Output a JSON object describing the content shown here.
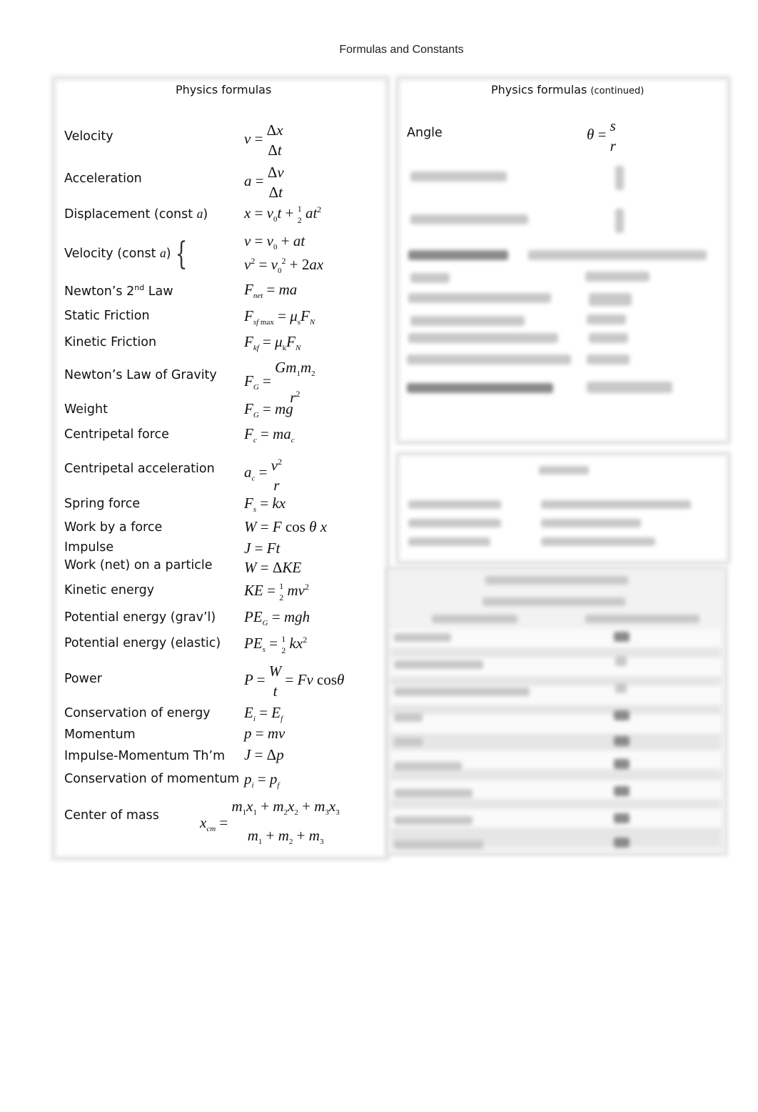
{
  "document": {
    "title": "Formulas and Constants"
  },
  "left_panel": {
    "heading": "Physics formulas",
    "rows": [
      {
        "label": "Velocity",
        "formula": "v = Δx / Δt"
      },
      {
        "label": "Acceleration",
        "formula": "a = Δv / Δt"
      },
      {
        "label": "Displacement (const a)",
        "formula": "x = v0 t + ½ a t²"
      },
      {
        "label": "Velocity (const a)",
        "formula": "v = v0 + at ; v² = v0² + 2ax"
      },
      {
        "label": "Newton’s 2nd Law",
        "formula": "F_net = ma"
      },
      {
        "label": "Static Friction",
        "formula": "F_sf max = μs F_N"
      },
      {
        "label": "Kinetic Friction",
        "formula": "F_kf = μk F_N"
      },
      {
        "label": "Newton’s Law of Gravity",
        "formula": "F_G = G m1 m2 / r²"
      },
      {
        "label": "Weight",
        "formula": "F_G = mg"
      },
      {
        "label": "Centripetal force",
        "formula": "F_c = m a_c"
      },
      {
        "label": "Centripetal acceleration",
        "formula": "a_c = v² / r"
      },
      {
        "label": "Spring force",
        "formula": "F_s = kx"
      },
      {
        "label": "Work by a force",
        "formula": "W = F cos θ x"
      },
      {
        "label": "Impulse",
        "formula": "J = Ft"
      },
      {
        "label": "Work (net) on a particle",
        "formula": "W = ΔKE"
      },
      {
        "label": "Kinetic energy",
        "formula": "KE = ½ m v²"
      },
      {
        "label": "Potential energy (grav’l)",
        "formula": "PE_G = mgh"
      },
      {
        "label": "Potential energy (elastic)",
        "formula": "PE_s = ½ k x²"
      },
      {
        "label": "Power",
        "formula": "P = W / t = F v cos θ"
      },
      {
        "label": "Conservation of energy",
        "formula": "E_i = E_f"
      },
      {
        "label": "Momentum",
        "formula": "p = mv"
      },
      {
        "label": "Impulse-Momentum Th’m",
        "formula": "J = Δp"
      },
      {
        "label": "Conservation of momentum",
        "formula": "p_i = p_f"
      },
      {
        "label": "Center of mass",
        "formula": "x_cm = (m1 x1 + m2 x2 + m3 x3) / (m1 + m2 + m3)"
      }
    ],
    "label_parts": {
      "displacement": "Displacement (const ",
      "velocity_const": "Velocity (const ",
      "a_var": "a",
      "close_paren": ")",
      "newton_pre": "Newton’s 2",
      "newton_sup": "nd",
      "newton_post": " Law"
    }
  },
  "right_panel": {
    "heading": "Physics formulas",
    "heading_note": "(continued)",
    "rows": [
      {
        "label": "Angle",
        "formula": "θ = s / r"
      }
    ],
    "blurred_rows_count": 10
  },
  "constants_panel": {
    "blurred": true
  },
  "table_panel": {
    "blurred": true
  }
}
